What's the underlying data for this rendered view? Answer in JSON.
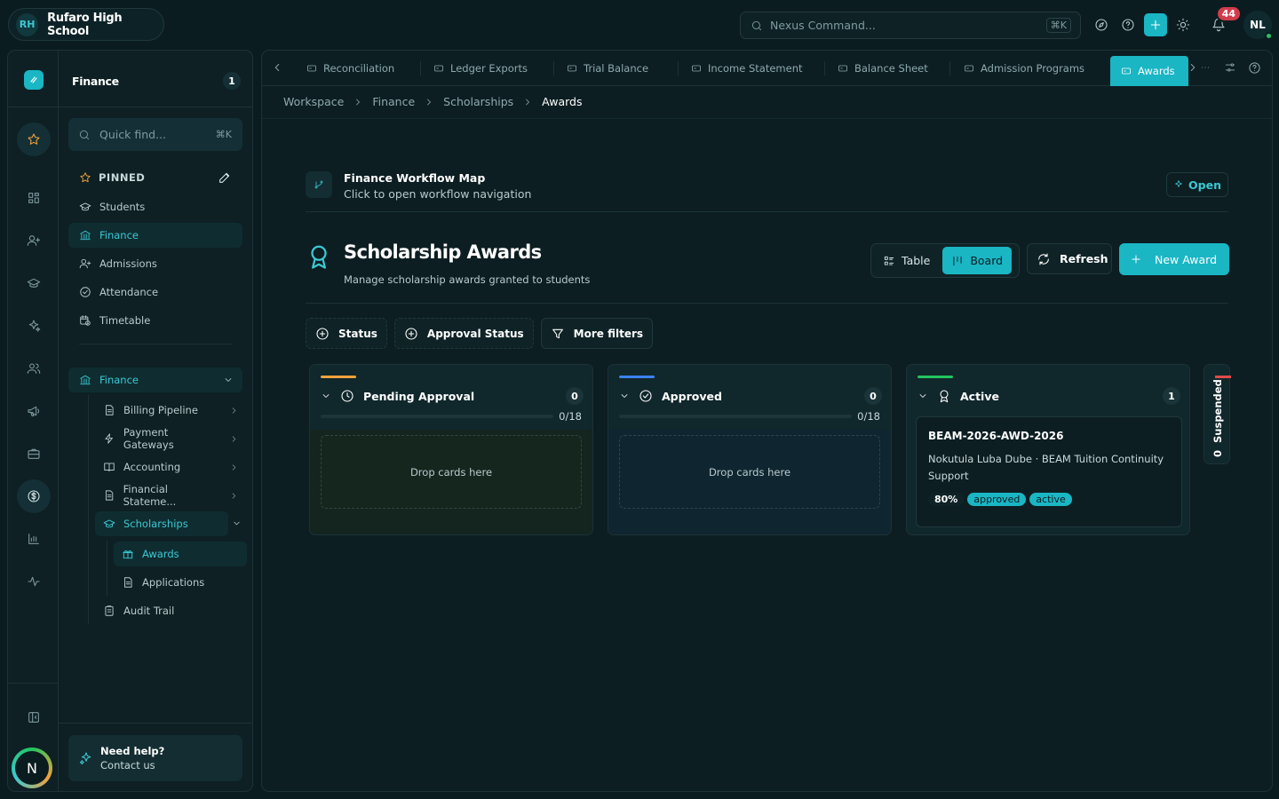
{
  "topbar": {
    "school_abbr": "RH",
    "school_name": "Rufaro High School",
    "command_placeholder": "Nexus Command...",
    "command_shortcut": "⌘K",
    "notification_count": "44",
    "user_initials": "NL"
  },
  "sidebar": {
    "title": "Finance",
    "count": "1",
    "quick_find_placeholder": "Quick find...",
    "quick_find_shortcut": "⌘K",
    "pinned_label": "PINNED",
    "pinned_items": [
      {
        "label": "Students",
        "icon": "graduation-cap-icon"
      },
      {
        "label": "Finance",
        "icon": "bank-icon"
      },
      {
        "label": "Admissions",
        "icon": "user-plus-icon"
      },
      {
        "label": "Attendance",
        "icon": "check-circle-icon"
      },
      {
        "label": "Timetable",
        "icon": "calendar-clock-icon"
      }
    ],
    "group_label": "Finance",
    "tree_items": [
      {
        "label": "Billing Pipeline",
        "icon": "document-icon"
      },
      {
        "label": "Payment Gateways",
        "icon": "lightning-icon"
      },
      {
        "label": "Accounting",
        "icon": "book-icon"
      },
      {
        "label": "Financial Stateme...",
        "icon": "document-icon"
      },
      {
        "label": "Scholarships",
        "icon": "graduation-cap-icon"
      },
      {
        "label": "Awards",
        "icon": "gift-icon"
      },
      {
        "label": "Applications",
        "icon": "document-icon"
      },
      {
        "label": "Audit Trail",
        "icon": "clipboard-icon"
      }
    ],
    "help_title": "Need help?",
    "help_subtitle": "Contact us",
    "rail_avatar": "N"
  },
  "tabs": [
    {
      "label": "Reconciliation"
    },
    {
      "label": "Ledger Exports"
    },
    {
      "label": "Trial Balance"
    },
    {
      "label": "Income Statement"
    },
    {
      "label": "Balance Sheet"
    },
    {
      "label": "Admission Programs"
    },
    {
      "label": "Awards"
    }
  ],
  "breadcrumb": [
    "Workspace",
    "Finance",
    "Scholarships",
    "Awards"
  ],
  "workflow": {
    "title": "Finance Workflow Map",
    "subtitle": "Click to open workflow navigation",
    "open_label": "Open"
  },
  "page": {
    "title": "Scholarship Awards",
    "subtitle": "Manage scholarship awards granted to students",
    "view_table": "Table",
    "view_board": "Board",
    "refresh_label": "Refresh",
    "new_label": "New Award"
  },
  "filters": {
    "status": "Status",
    "approval_status": "Approval Status",
    "more": "More filters"
  },
  "colors": {
    "accent": "#1ab6c4",
    "pending": "#f2a23b",
    "approved": "#3b82f6",
    "active": "#22c55e",
    "suspended": "#e04b4b"
  },
  "columns": [
    {
      "name": "Pending Approval",
      "count": "0",
      "progress": "0/18",
      "progress_value": 0,
      "drop": "Drop cards here",
      "icon": "clock-icon"
    },
    {
      "name": "Approved",
      "count": "0",
      "progress": "0/18",
      "progress_value": 0,
      "drop": "Drop cards here",
      "icon": "check-circle-icon"
    },
    {
      "name": "Active",
      "count": "1",
      "icon": "award-icon"
    },
    {
      "name": "Suspended",
      "count": "0"
    }
  ],
  "card": {
    "id": "BEAM-2026-AWD-2026",
    "description": "Nokutula Luba Dube · BEAM Tuition Continuity Support",
    "percent": "80%",
    "tag1": "approved",
    "tag2": "active"
  }
}
